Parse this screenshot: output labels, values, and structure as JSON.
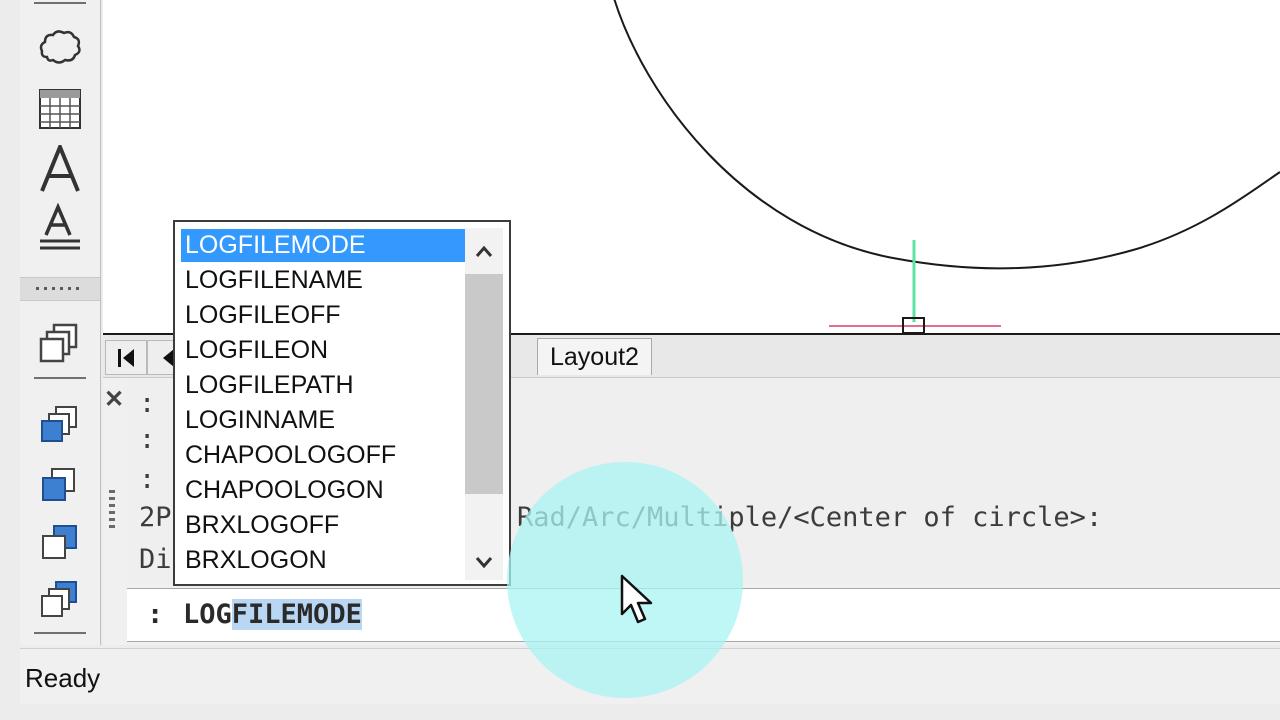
{
  "autocomplete": {
    "items": [
      "LOGFILEMODE",
      "LOGFILENAME",
      "LOGFILEOFF",
      "LOGFILEON",
      "LOGFILEPATH",
      "LOGINNAME",
      "CHAPOOLOGOFF",
      "CHAPOOLOGON",
      "BRXLOGOFF",
      "BRXLOGON"
    ],
    "selected": "LOGFILEMODE"
  },
  "tabs": {
    "layout2": "Layout2"
  },
  "history": {
    "lines": [
      ":",
      ":",
      ":",
      "2P",
      "Di"
    ],
    "visible_fragment": "Rad/Arc/Multiple/<Center of circle>:"
  },
  "command_line": {
    "prompt": ":",
    "typed": "LOG",
    "autocompleted": "FILEMODE"
  },
  "status": {
    "text": "Ready"
  },
  "toolbar": {
    "tools": [
      "revision-cloud-icon",
      "table-icon",
      "multiline-text-icon",
      "single-line-text-icon",
      "copy-icon",
      "bring-to-front-icon",
      "send-to-back-icon",
      "bring-above-icon",
      "send-under-icon"
    ]
  },
  "colors": {
    "selection": "#3399ff",
    "y_axis": "#5be3a1",
    "x_axis": "#e56f8a",
    "cursor_halo": "#aaf4f4"
  }
}
